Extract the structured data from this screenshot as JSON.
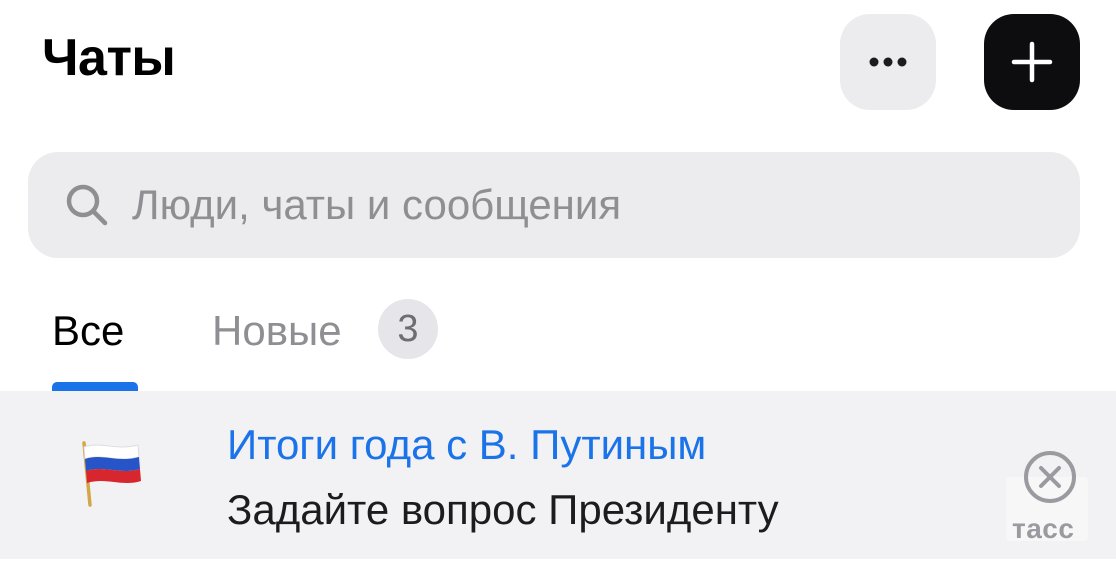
{
  "header": {
    "title": "Чаты",
    "more_icon": "ellipsis-icon",
    "add_icon": "plus-icon"
  },
  "search": {
    "icon": "search-icon",
    "placeholder": "Люди, чаты и сообщения"
  },
  "tabs": [
    {
      "label": "Все",
      "active": true
    },
    {
      "label": "Новые",
      "badge": "3",
      "active": false
    }
  ],
  "banner": {
    "icon": "russian-flag-icon",
    "title": "Итоги года с В. Путиным",
    "subtitle": "Задайте вопрос Президенту",
    "close_icon": "close-circle-icon",
    "source": "тасс"
  },
  "colors": {
    "accent": "#1a73e8",
    "dark_button": "#0d0d0f",
    "light_button": "#ececee",
    "banner_bg": "#f2f2f4",
    "muted_text": "#8e8e93"
  }
}
